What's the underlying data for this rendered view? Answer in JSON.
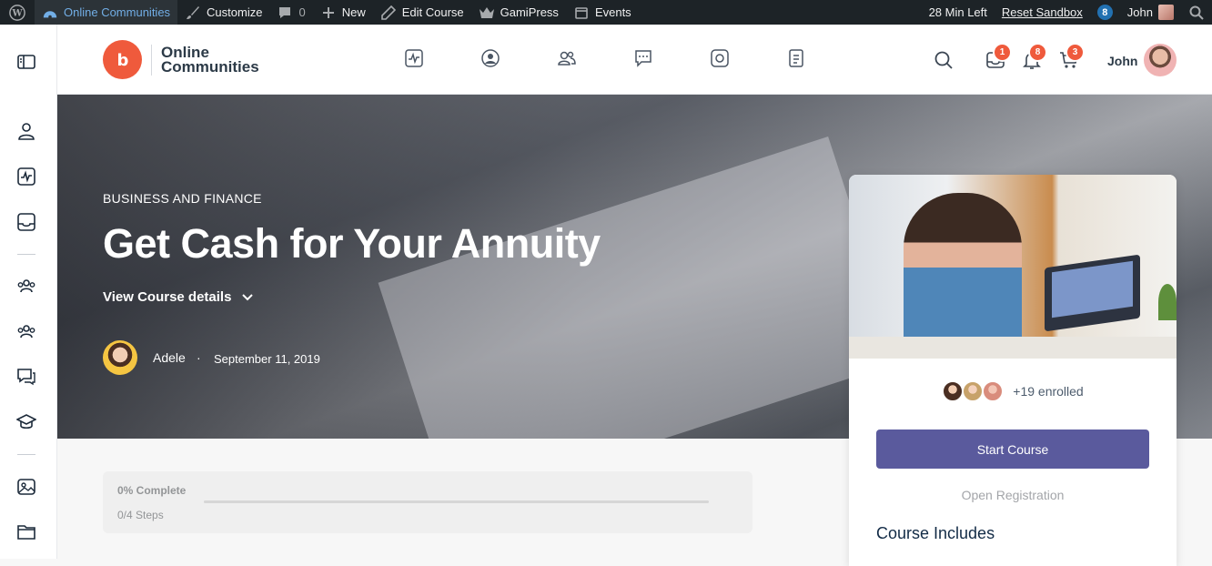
{
  "admin_bar": {
    "site_name": "Online Communities",
    "customize": "Customize",
    "comments_count": "0",
    "new_label": "New",
    "edit_course": "Edit Course",
    "gamipress": "GamiPress",
    "events": "Events",
    "time_left": "28 Min Left",
    "reset_sandbox": "Reset Sandbox",
    "notification_count": "8",
    "user_name": "John"
  },
  "header": {
    "logo_text": "Online Communities",
    "messages_count": "1",
    "notifications_count": "8",
    "cart_count": "3",
    "user_name": "John"
  },
  "hero": {
    "category": "BUSINESS AND FINANCE",
    "title": "Get Cash for Your Annuity",
    "details_label": "View Course details",
    "author": "Adele",
    "separator": "·",
    "date": "September 11, 2019"
  },
  "progress": {
    "percent_label": "0% Complete",
    "percent_value": 0,
    "steps_label": "0/4 Steps"
  },
  "course_card": {
    "enrolled_text": "+19 enrolled",
    "start_button": "Start Course",
    "open_registration": "Open Registration",
    "includes_heading": "Course Includes"
  },
  "colors": {
    "accent": "#ef5a3c",
    "button": "#5a5a9d",
    "admin_bar": "#1d2327"
  }
}
